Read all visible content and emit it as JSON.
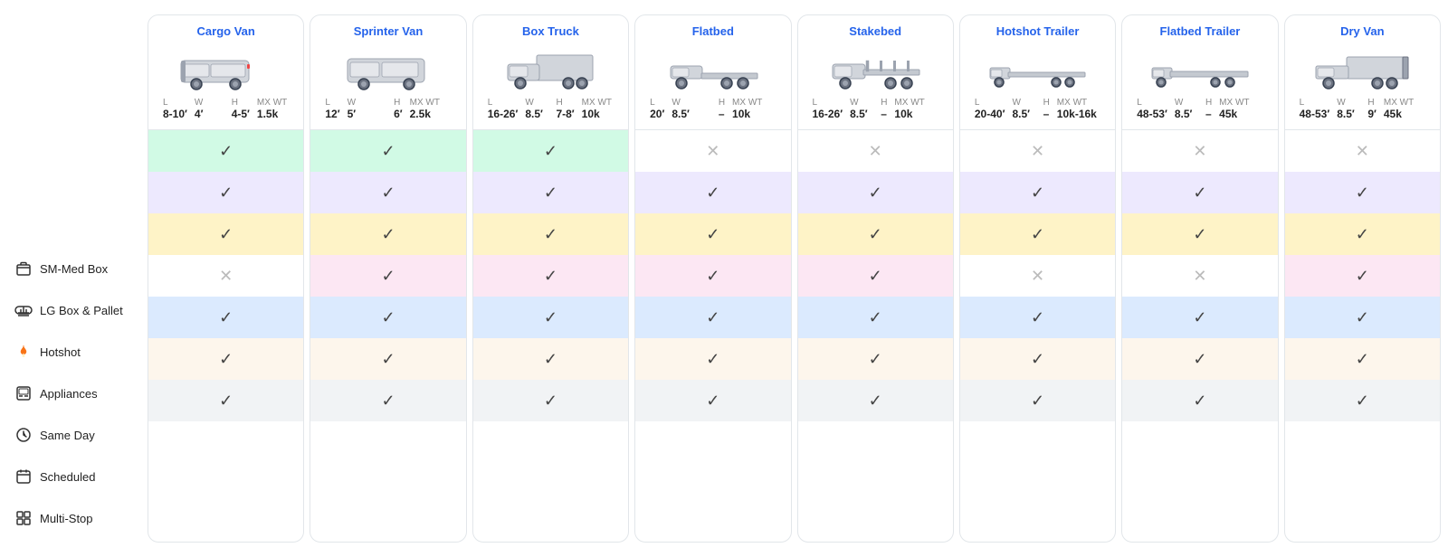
{
  "sidebar": {
    "items": [
      {
        "id": "sm-med-box",
        "label": "SM-Med Box",
        "icon": "📦",
        "active": false
      },
      {
        "id": "lg-box-pallet",
        "label": "LG Box & Pallet",
        "icon": "◇",
        "active": false
      },
      {
        "id": "hotshot",
        "label": "Hotshot",
        "icon": "🔥",
        "active": false
      },
      {
        "id": "appliances",
        "label": "Appliances",
        "icon": "📅",
        "active": false
      },
      {
        "id": "same-day",
        "label": "Same Day",
        "icon": "🕐",
        "active": false
      },
      {
        "id": "scheduled",
        "label": "Scheduled",
        "icon": "📆",
        "active": false
      },
      {
        "id": "multi-stop",
        "label": "Multi-Stop",
        "icon": "⊞",
        "active": false
      }
    ]
  },
  "columns": [
    {
      "id": "cargo-van",
      "title": "Cargo Van",
      "specs": {
        "L": "8-10′",
        "W": "4′",
        "H": "4-5′",
        "MX_WT": "1.5k"
      },
      "cells": [
        "green-check",
        "purple-check",
        "yellow-check",
        "white-cross",
        "blue-check",
        "tan-check",
        "gray-check"
      ]
    },
    {
      "id": "sprinter-van",
      "title": "Sprinter Van",
      "specs": {
        "L": "12′",
        "W": "5′",
        "H": "6′",
        "MX_WT": "2.5k"
      },
      "cells": [
        "green-check",
        "purple-check",
        "yellow-check",
        "pink-check",
        "blue-check",
        "tan-check",
        "gray-check"
      ]
    },
    {
      "id": "box-truck",
      "title": "Box Truck",
      "specs": {
        "L": "16-26′",
        "W": "8.5′",
        "H": "7-8′",
        "MX_WT": "10k"
      },
      "cells": [
        "green-check",
        "purple-check",
        "yellow-check",
        "pink-check",
        "blue-check",
        "tan-check",
        "gray-check"
      ]
    },
    {
      "id": "flatbed",
      "title": "Flatbed",
      "specs": {
        "L": "20′",
        "W": "8.5′",
        "H": "–",
        "MX_WT": "10k"
      },
      "cells": [
        "white-cross",
        "purple-check",
        "yellow-check",
        "pink-check",
        "blue-check",
        "tan-check",
        "gray-check"
      ]
    },
    {
      "id": "stakebed",
      "title": "Stakebed",
      "specs": {
        "L": "16-26′",
        "W": "8.5′",
        "H": "–",
        "MX_WT": "10k"
      },
      "cells": [
        "white-cross",
        "purple-check",
        "yellow-check",
        "pink-check",
        "blue-check",
        "tan-check",
        "gray-check"
      ]
    },
    {
      "id": "hotshot-trailer",
      "title": "Hotshot Trailer",
      "specs": {
        "L": "20-40′",
        "W": "8.5′",
        "H": "–",
        "MX_WT": "10k-16k"
      },
      "cells": [
        "white-cross",
        "purple-check",
        "yellow-check",
        "white-cross",
        "blue-check",
        "tan-check",
        "gray-check"
      ]
    },
    {
      "id": "flatbed-trailer",
      "title": "Flatbed Trailer",
      "specs": {
        "L": "48-53′",
        "W": "8.5′",
        "H": "–",
        "MX_WT": "45k"
      },
      "cells": [
        "white-cross",
        "purple-check",
        "yellow-check",
        "white-cross",
        "blue-check",
        "tan-check",
        "gray-check"
      ]
    },
    {
      "id": "dry-van",
      "title": "Dry Van",
      "specs": {
        "L": "48-53′",
        "W": "8.5′",
        "H": "9′",
        "MX_WT": "45k"
      },
      "cells": [
        "white-cross",
        "purple-check",
        "yellow-check",
        "pink-check",
        "blue-check",
        "tan-check",
        "gray-check"
      ]
    }
  ],
  "labels": {
    "L": "L",
    "W": "W",
    "H": "H",
    "MX_WT": "MX WT"
  }
}
